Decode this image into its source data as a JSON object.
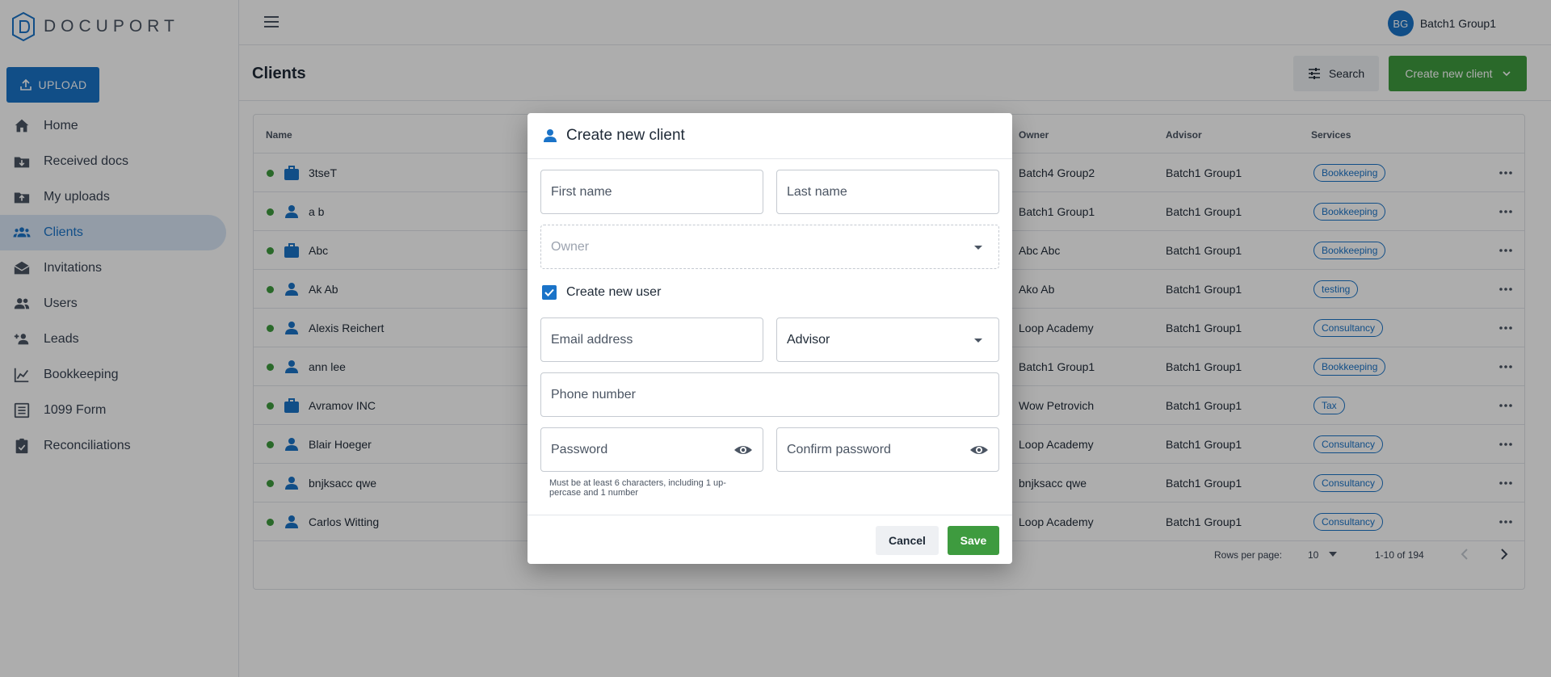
{
  "app": {
    "name": "DOCUPORT"
  },
  "sidebar": {
    "upload_label": "UPLOAD",
    "items": [
      {
        "label": "Home",
        "icon": "home-icon",
        "active": false
      },
      {
        "label": "Received docs",
        "icon": "received-docs-icon",
        "active": false
      },
      {
        "label": "My uploads",
        "icon": "upload-folder-icon",
        "active": false
      },
      {
        "label": "Clients",
        "icon": "clients-icon",
        "active": true
      },
      {
        "label": "Invitations",
        "icon": "envelope-icon",
        "active": false
      },
      {
        "label": "Users",
        "icon": "users-icon",
        "active": false
      },
      {
        "label": "Leads",
        "icon": "leads-icon",
        "active": false
      },
      {
        "label": "Bookkeeping",
        "icon": "chart-icon",
        "active": false
      },
      {
        "label": "1099 Form",
        "icon": "form-icon",
        "active": false
      },
      {
        "label": "Reconciliations",
        "icon": "clipboard-icon",
        "active": false
      }
    ]
  },
  "topbar": {
    "user_initials": "BG",
    "user_name": "Batch1 Group1"
  },
  "page": {
    "title": "Clients",
    "search_label": "Search",
    "create_label": "Create new client"
  },
  "table": {
    "columns": {
      "name": "Name",
      "owner": "Owner",
      "advisor": "Advisor",
      "services": "Services"
    },
    "rows": [
      {
        "name": "3tseT",
        "type": "business",
        "owner": "Batch4 Group2",
        "advisor": "Batch1 Group1",
        "service": "Bookkeeping"
      },
      {
        "name": "a b",
        "type": "person",
        "owner": "Batch1 Group1",
        "advisor": "Batch1 Group1",
        "service": "Bookkeeping"
      },
      {
        "name": "Abc",
        "type": "business",
        "owner": "Abc Abc",
        "advisor": "Batch1 Group1",
        "service": "Bookkeeping"
      },
      {
        "name": "Ak Ab",
        "type": "person",
        "owner": "Ako Ab",
        "advisor": "Batch1 Group1",
        "service": "testing"
      },
      {
        "name": "Alexis Reichert",
        "type": "person",
        "owner": "Loop Academy",
        "advisor": "Batch1 Group1",
        "service": "Consultancy"
      },
      {
        "name": "ann lee",
        "type": "person",
        "owner": "Batch1 Group1",
        "advisor": "Batch1 Group1",
        "service": "Bookkeeping"
      },
      {
        "name": "Avramov INC",
        "type": "business",
        "owner": "Wow Petrovich",
        "advisor": "Batch1 Group1",
        "service": "Tax"
      },
      {
        "name": "Blair Hoeger",
        "type": "person",
        "owner": "Loop Academy",
        "advisor": "Batch1 Group1",
        "service": "Consultancy"
      },
      {
        "name": "bnjksacc qwe",
        "type": "person",
        "owner": "bnjksacc qwe",
        "advisor": "Batch1 Group1",
        "service": "Consultancy"
      },
      {
        "name": "Carlos Witting",
        "type": "person",
        "owner": "Loop Academy",
        "advisor": "Batch1 Group1",
        "service": "Consultancy"
      }
    ],
    "pagination": {
      "rows_per_page_label": "Rows per page:",
      "rows_per_page": "10",
      "range": "1-10 of 194"
    }
  },
  "dialog": {
    "title": "Create new client",
    "first_name_placeholder": "First name",
    "last_name_placeholder": "Last name",
    "owner_placeholder": "Owner",
    "create_user_label": "Create new user",
    "create_user_checked": true,
    "email_placeholder": "Email address",
    "advisor_placeholder": "Advisor",
    "phone_placeholder": "Phone number",
    "password_placeholder": "Password",
    "confirm_password_placeholder": "Confirm password",
    "password_hint_line1": "Must be at least 6 characters, including 1 up-",
    "password_hint_line2": "percase and 1 number",
    "cancel_label": "Cancel",
    "save_label": "Save"
  },
  "colors": {
    "primary": "#1a73c8",
    "success": "#3e9b3f",
    "active_nav_bg": "#d9e6f6"
  }
}
